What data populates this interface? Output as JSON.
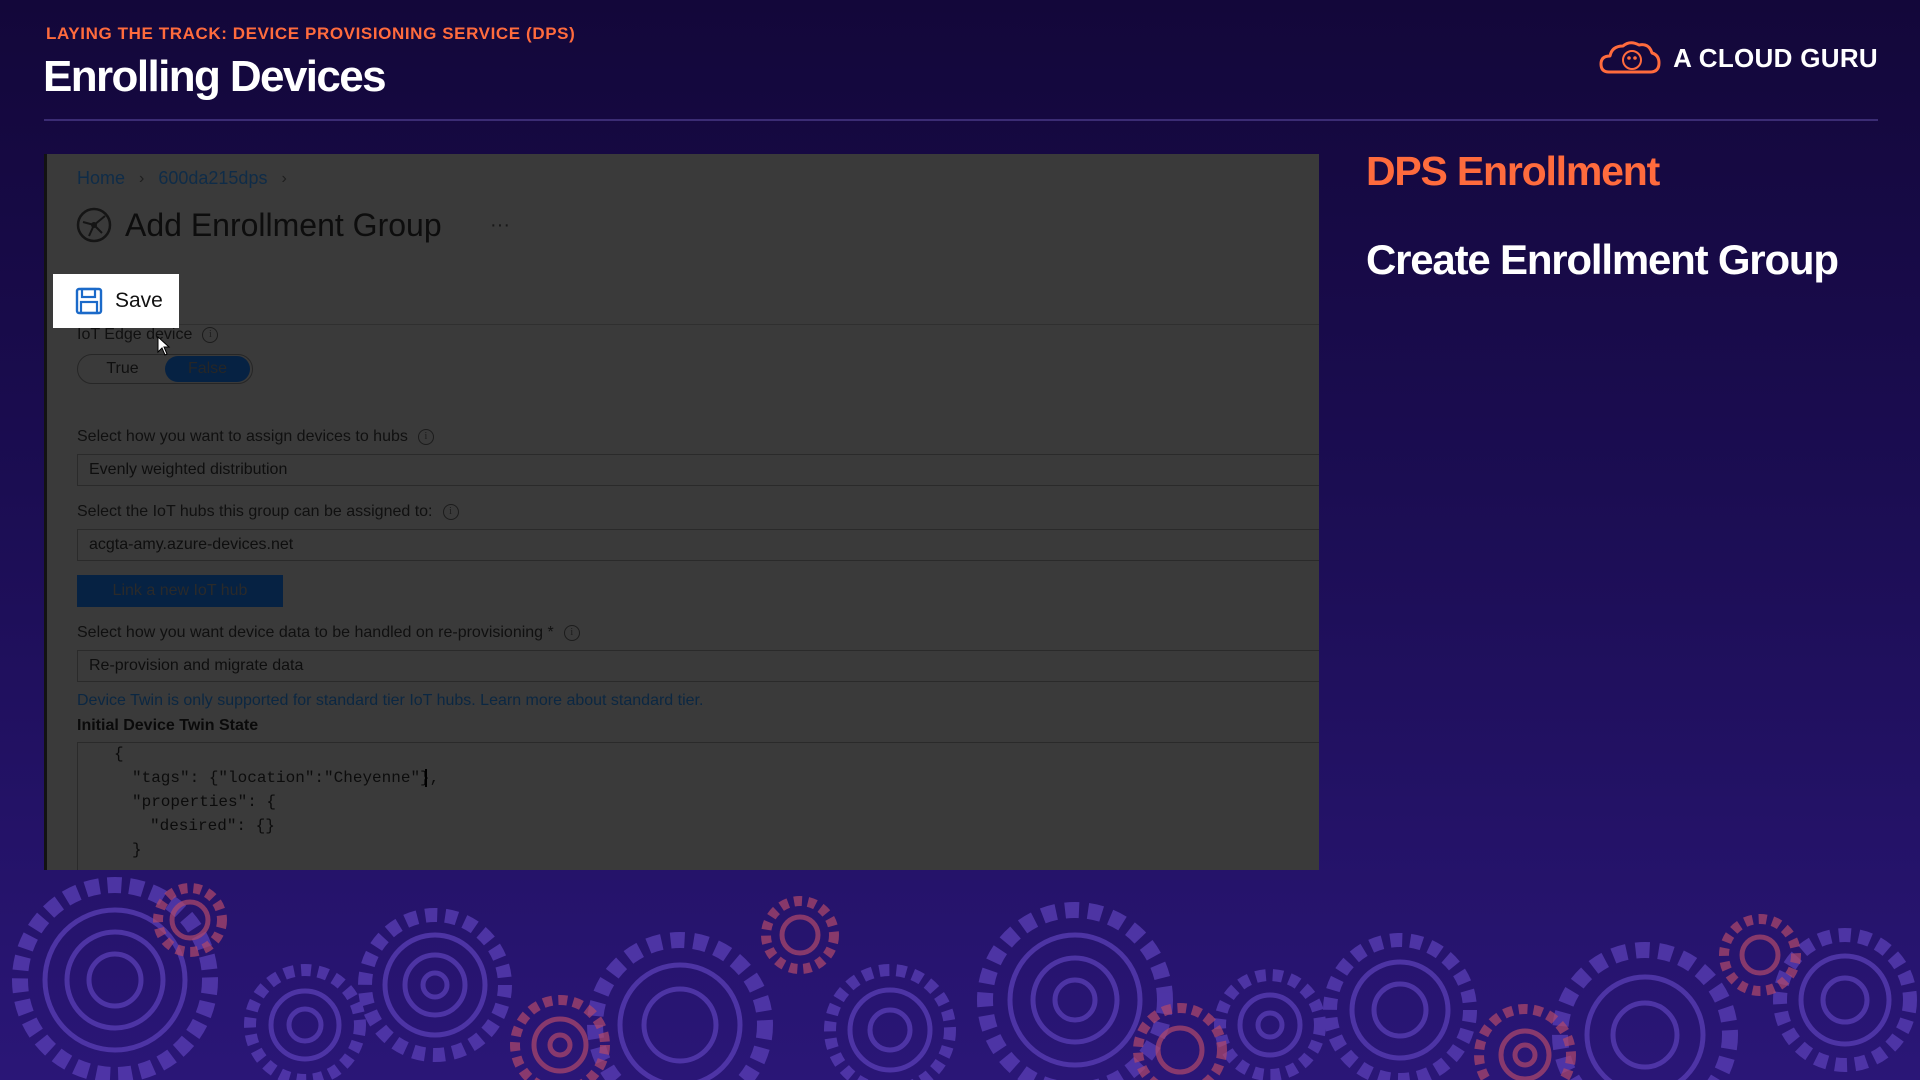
{
  "slide": {
    "eyebrow": "LAYING THE TRACK: DEVICE PROVISIONING SERVICE (DPS)",
    "title": "Enrolling Devices",
    "brand": "A CLOUD GURU",
    "side_subtitle": "DPS Enrollment",
    "side_heading": "Create Enrollment Group"
  },
  "portal": {
    "breadcrumb": [
      "Home",
      "600da215dps"
    ],
    "page_title": "Add Enrollment Group",
    "more_label": "···",
    "save_label": "Save",
    "iot_edge": {
      "label": "IoT Edge device",
      "options": [
        "True",
        "False"
      ],
      "selected": "False"
    },
    "assign": {
      "label": "Select how you want to assign devices to hubs",
      "value": "Evenly weighted distribution"
    },
    "hubs": {
      "label": "Select the IoT hubs this group can be assigned to:",
      "value": "acgta-amy.azure-devices.net"
    },
    "link_hub_label": "Link a new IoT hub",
    "reprovision": {
      "label": "Select how you want device data to be handled on re-provisioning *",
      "value": "Re-provision and migrate data"
    },
    "notice": "Device Twin is only supported for standard tier IoT hubs. Learn more about standard tier.",
    "twin_label": "Initial Device Twin State",
    "twin_code": [
      "{",
      "\"tags\": {\"location\":\"Cheyenne\"},",
      "\"properties\": {",
      "\"desired\": {}",
      "}"
    ]
  },
  "colors": {
    "accent": "#ff6b3d",
    "background": "#1b0d52",
    "azure_primary": "#062243"
  },
  "icons": [
    "cloud-logo-icon",
    "enrollment-group-icon",
    "save-icon",
    "info-icon",
    "chevron-right-icon",
    "cursor-icon",
    "gear-icon"
  ]
}
